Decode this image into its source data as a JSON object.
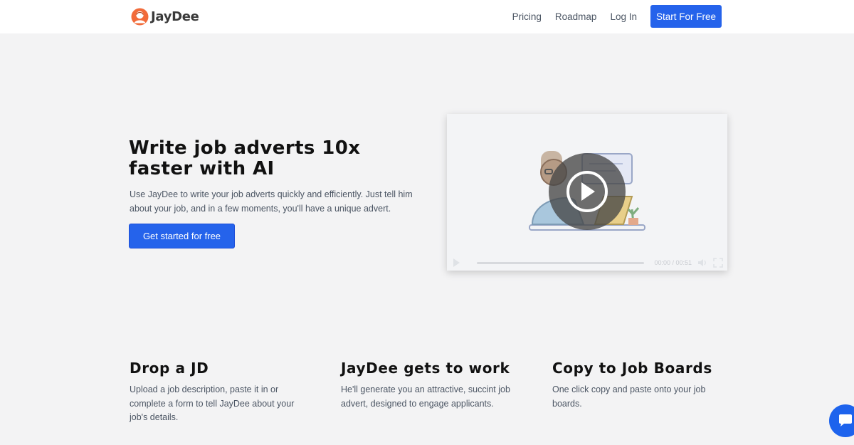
{
  "header": {
    "brand": "JayDee",
    "nav": [
      "Pricing",
      "Roadmap",
      "Log In"
    ],
    "cta": "Start For Free"
  },
  "hero": {
    "title": "Write job adverts 10x faster with AI",
    "subtitle": "Use JayDee to write your job adverts quickly and efficiently. Just tell him about your job, and in a few moments, you'll have a unique advert.",
    "cta": "Get started for free"
  },
  "video": {
    "time": "00:00 / 00:51"
  },
  "features": [
    {
      "title": "Drop a JD",
      "text": "Upload a job description, paste it in or complete a form to tell JayDee about your job's details."
    },
    {
      "title": "JayDee gets to work",
      "text": "He'll generate you an attractive, succint job advert, designed to engage applicants."
    },
    {
      "title": "Copy to Job Boards",
      "text": "One click copy and paste onto your job boards."
    }
  ],
  "colors": {
    "accent": "#2563eb",
    "logo": "#f26b3a"
  },
  "icons": [
    "logo-icon",
    "play-icon",
    "volume-icon",
    "fullscreen-icon",
    "chat-icon"
  ]
}
